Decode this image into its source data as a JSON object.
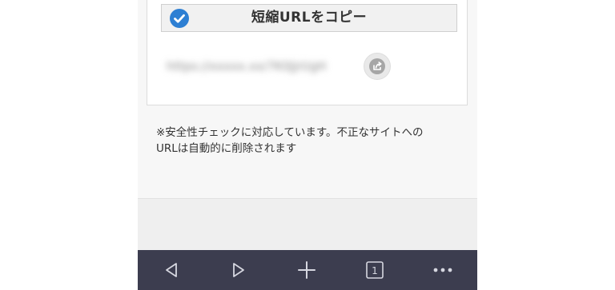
{
  "card": {
    "copy_button_label": "短縮URLをコピー",
    "short_url": "https://xxxxx.xx/7K0Jjrl/gH",
    "share_icon": "share-icon",
    "check_icon": "checkmark-circle-icon"
  },
  "notice": {
    "line1": "※安全性チェックに対応しています。不正なサイトへの",
    "line2": "URLは自動的に削除されます"
  },
  "toolbar": {
    "tab_count": "1",
    "icons": [
      "back-icon",
      "forward-icon",
      "plus-icon",
      "tabs-icon",
      "more-icon"
    ]
  },
  "colors": {
    "accent_check": "#2d7fd3",
    "toolbar_bg": "#3c3d4f",
    "toolbar_icon": "#d6d7e0"
  }
}
